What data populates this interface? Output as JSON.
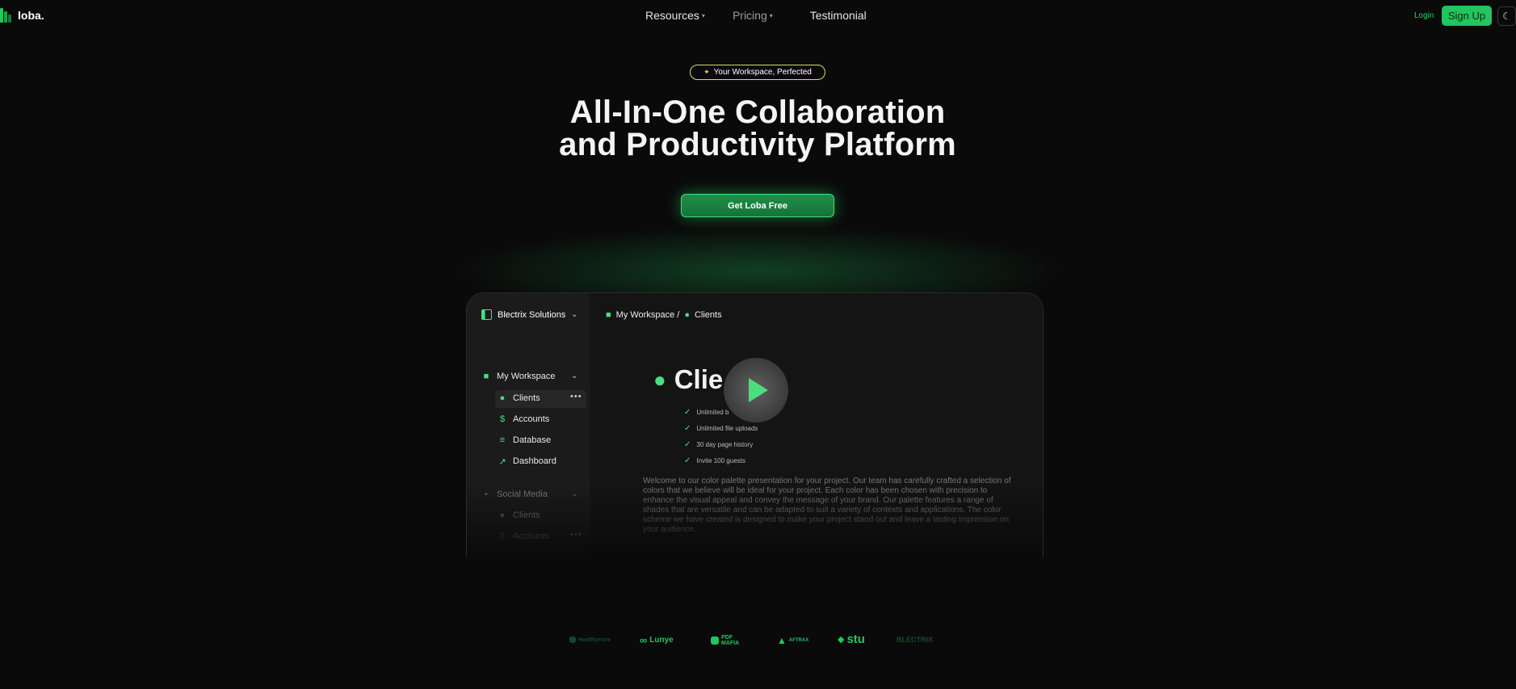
{
  "nav": {
    "brand": "loba.",
    "links": [
      {
        "label": "Resources",
        "has_caret": true
      },
      {
        "label": "Pricing",
        "has_caret": true
      },
      {
        "label": "Testimonial",
        "has_caret": false
      }
    ],
    "login": "Login",
    "signup": "Sign Up",
    "theme_icon": "moon-icon"
  },
  "hero": {
    "badge_icon": "sparkle-icon",
    "badge": "Your Workspace, Perfected",
    "title_line1": "All-In-One Collaboration",
    "title_line2": "and Productivity Platform",
    "cta": "Get Loba Free"
  },
  "preview": {
    "workspace_name": "Blectrix Solutions",
    "sidebar": {
      "group1": "My Workspace",
      "group1_items": [
        "Clients",
        "Accounts",
        "Database",
        "Dashboard"
      ],
      "group2": "Social Media",
      "group2_items": [
        "Clients",
        "Accounts"
      ]
    },
    "breadcrumb": [
      "My Workspace /",
      "Clients"
    ],
    "heading": "Clie",
    "features": [
      "Unlimited b",
      "Unlimited file uploads",
      "30 day page history",
      "Invite 100 guests"
    ],
    "paragraph": "Welcome to our color palette presentation for your project. Our team has carefully crafted a selection of colors that we believe will be ideal for your project. Each color has been chosen with precision to enhance the visual appeal and convey the message of your brand. Our palette features a range of shades that are versatile and can be adapted to suit a variety of contexts and applications. The color scheme we have created is designed to make your project stand out and leave a lasting impression on your audience."
  },
  "partners": [
    "Healthyncre",
    "Lunye",
    "PDF MAFIA",
    "AFTRAX",
    "stu",
    "BLECTRIX"
  ],
  "colors": {
    "accent": "#22c55e",
    "accent_light": "#4ade80",
    "background": "#0a0a0a"
  }
}
